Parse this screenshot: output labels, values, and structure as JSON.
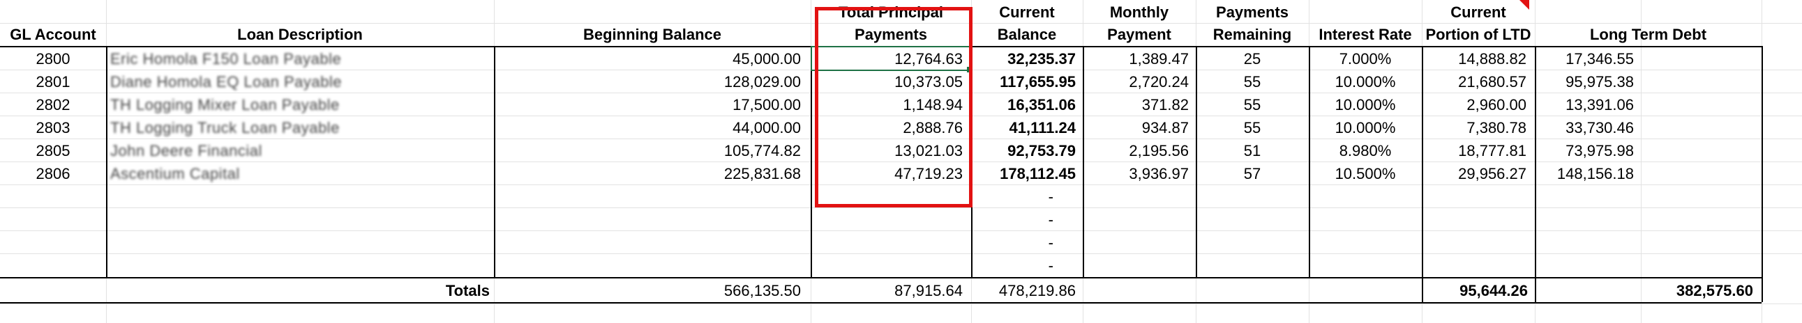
{
  "headers": {
    "gl_account": [
      "",
      "GL Account"
    ],
    "loan_description": [
      "",
      "Loan Description"
    ],
    "beginning_balance": [
      "",
      "Beginning Balance"
    ],
    "total_principal": [
      "Total Principal",
      "Payments"
    ],
    "current_balance": [
      "Current",
      "Balance"
    ],
    "monthly_payment": [
      "Monthly",
      "Payment"
    ],
    "payments_remaining": [
      "Payments",
      "Remaining"
    ],
    "interest_rate": [
      "",
      "Interest Rate"
    ],
    "current_portion": [
      "Current",
      "Portion of LTD"
    ],
    "long_term_debt": [
      "",
      "Long Term Debt"
    ]
  },
  "rows": [
    {
      "gl": "2800",
      "desc": "Eric Homola F150 Loan Payable",
      "begin": "45,000.00",
      "principal": "12,764.63",
      "current": "32,235.37",
      "monthly": "1,389.47",
      "remaining": "25",
      "rate": "7.000%",
      "portion": "14,888.82",
      "ltd": "17,346.55"
    },
    {
      "gl": "2801",
      "desc": "Diane Homola EQ Loan Payable",
      "begin": "128,029.00",
      "principal": "10,373.05",
      "current": "117,655.95",
      "monthly": "2,720.24",
      "remaining": "55",
      "rate": "10.000%",
      "portion": "21,680.57",
      "ltd": "95,975.38"
    },
    {
      "gl": "2802",
      "desc": "TH Logging Mixer Loan Payable",
      "begin": "17,500.00",
      "principal": "1,148.94",
      "current": "16,351.06",
      "monthly": "371.82",
      "remaining": "55",
      "rate": "10.000%",
      "portion": "2,960.00",
      "ltd": "13,391.06"
    },
    {
      "gl": "2803",
      "desc": "TH Logging Truck Loan Payable",
      "begin": "44,000.00",
      "principal": "2,888.76",
      "current": "41,111.24",
      "monthly": "934.87",
      "remaining": "55",
      "rate": "10.000%",
      "portion": "7,380.78",
      "ltd": "33,730.46"
    },
    {
      "gl": "2805",
      "desc": "John Deere Financial",
      "begin": "105,774.82",
      "principal": "13,021.03",
      "current": "92,753.79",
      "monthly": "2,195.56",
      "remaining": "51",
      "rate": "8.980%",
      "portion": "18,777.81",
      "ltd": "73,975.98"
    },
    {
      "gl": "2806",
      "desc": "Ascentium Capital",
      "begin": "225,831.68",
      "principal": "47,719.23",
      "current": "178,112.45",
      "monthly": "3,936.97",
      "remaining": "57",
      "rate": "10.500%",
      "portion": "29,956.27",
      "ltd": "148,156.18"
    }
  ],
  "empty_row_marker": "-",
  "totals": {
    "label": "Totals",
    "begin": "566,135.50",
    "principal": "87,915.64",
    "current": "478,219.86",
    "portion": "95,644.26",
    "ltd": "382,575.60"
  },
  "colors": {
    "highlight_box": "#e21212",
    "selection": "#1e7145",
    "gridline": "#e2e2e2"
  }
}
